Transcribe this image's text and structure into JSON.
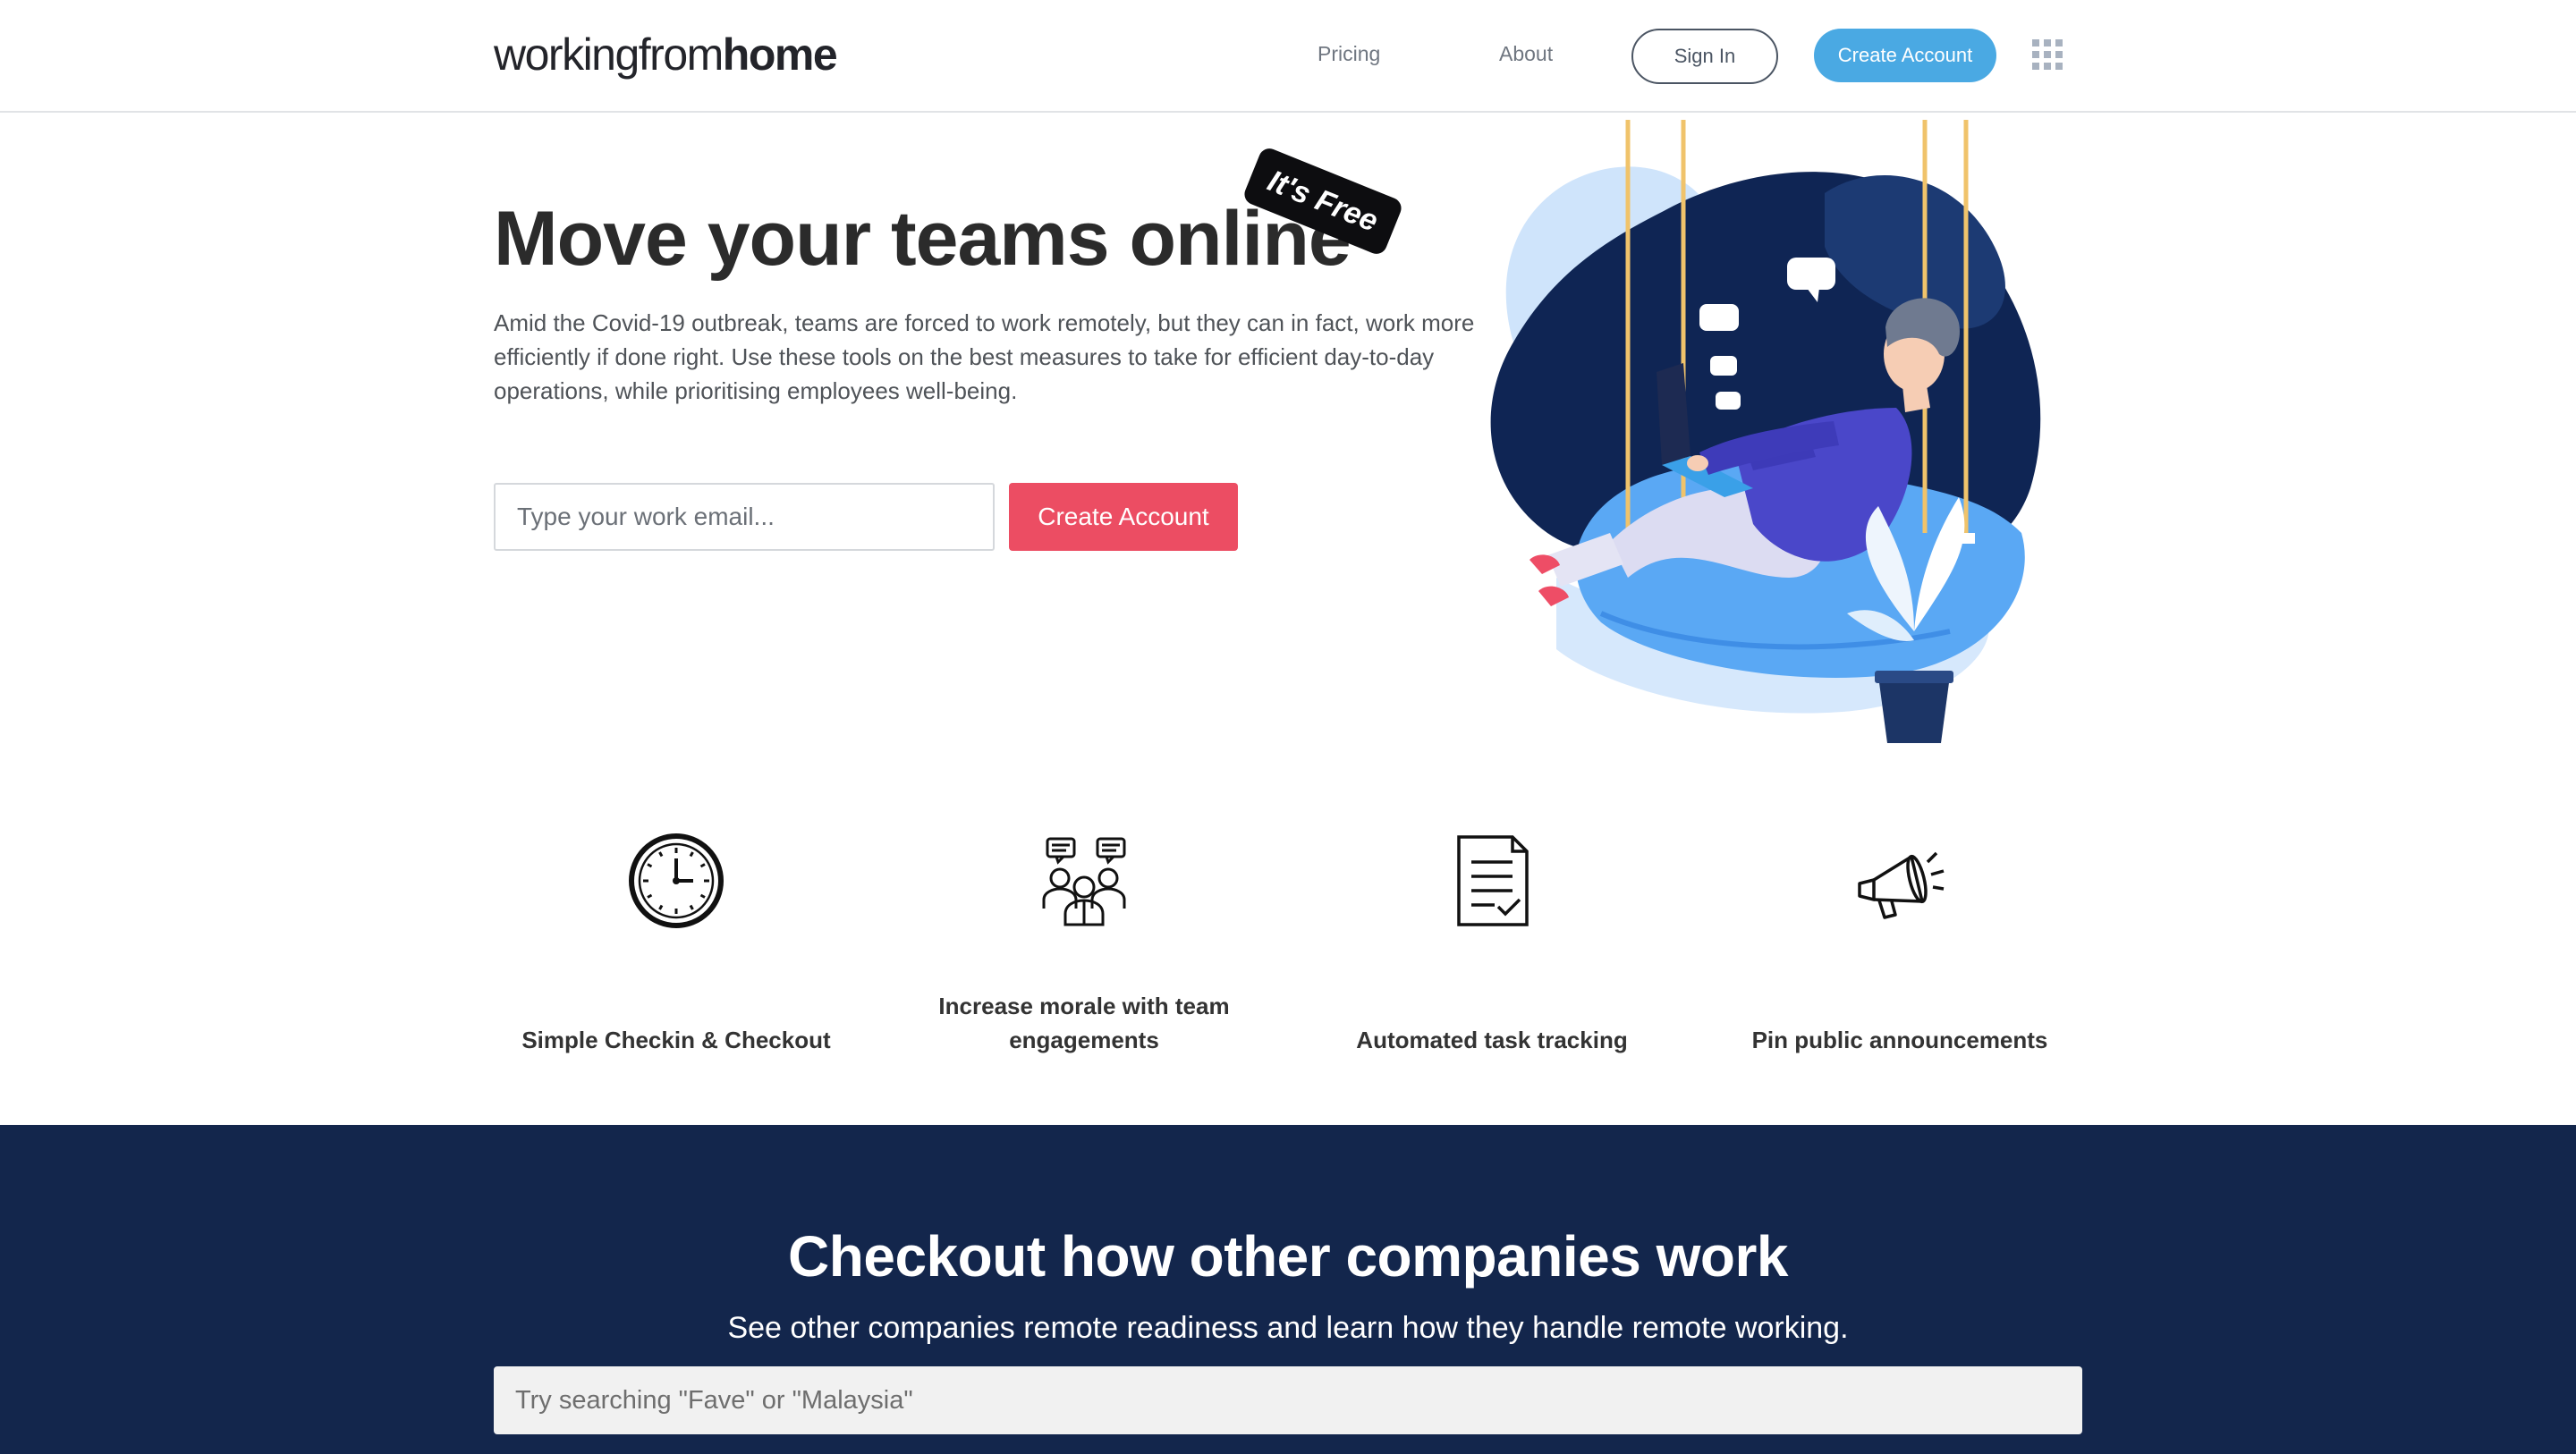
{
  "header": {
    "logo_light": "workingfrom",
    "logo_bold": "home",
    "nav": [
      "Pricing",
      "About"
    ],
    "signin_label": "Sign In",
    "create_label": "Create Account",
    "apps_icon": "apps-grid-icon"
  },
  "hero": {
    "title": "Move your teams online",
    "badge": "It's Free",
    "description": "Amid the Covid-19 outbreak, teams are forced to work remotely, but they can in fact, work more efficiently if done right. Use these tools on the best measures to take for efficient day-to-day operations, while prioritising employees well-being.",
    "email_placeholder": "Type your work email...",
    "create_label": "Create Account"
  },
  "features": [
    {
      "icon": "clock-icon",
      "label": "Simple Checkin & Checkout"
    },
    {
      "icon": "team-chat-icon",
      "label": "Increase morale with team engagements"
    },
    {
      "icon": "document-check-icon",
      "label": "Automated task tracking"
    },
    {
      "icon": "megaphone-icon",
      "label": "Pin public announcements"
    }
  ],
  "companies": {
    "title": "Checkout how other companies work",
    "subtitle": "See other companies remote readiness and learn how they handle remote working.",
    "search_placeholder": "Try searching \"Fave\" or \"Malaysia\""
  },
  "colors": {
    "primary_blue": "#4aa9e3",
    "cta_red": "#ec4d63",
    "navy": "#13264c"
  }
}
